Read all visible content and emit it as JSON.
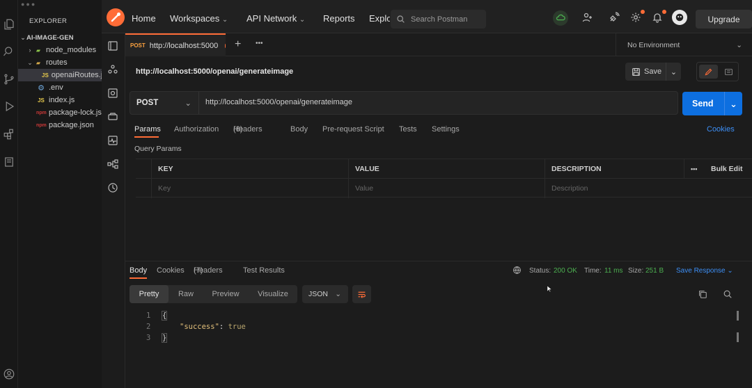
{
  "vscode": {
    "explorer_title": "EXPLORER",
    "project": "AI-IMAGE-GEN",
    "tree": [
      {
        "label": "node_modules",
        "type": "folder",
        "icon": "folder-icon",
        "expanded": false
      },
      {
        "label": "routes",
        "type": "folder",
        "icon": "folder-icon",
        "expanded": true
      },
      {
        "label": "openaiRoutes.js",
        "type": "js",
        "icon": "js-file-icon",
        "selected": true
      },
      {
        "label": ".env",
        "type": "env",
        "icon": "gear-icon"
      },
      {
        "label": "index.js",
        "type": "js",
        "icon": "js-file-icon"
      },
      {
        "label": "package-lock.json",
        "type": "json",
        "icon": "npm-icon"
      },
      {
        "label": "package.json",
        "type": "json",
        "icon": "npm-icon"
      }
    ],
    "file_icon_js": "JS",
    "file_icon_npm": "npm"
  },
  "postman": {
    "nav": [
      "Home",
      "Workspaces",
      "API Network",
      "Reports",
      "Explo"
    ],
    "search_placeholder": "Search Postman",
    "upgrade_label": "Upgrade",
    "tab": {
      "method": "POST",
      "label": "http://localhost:5000"
    },
    "environment": "No Environment",
    "request_title": "http://localhost:5000/openai/generateimage",
    "save_label": "Save",
    "method": "POST",
    "url": "http://localhost:5000/openai/generateimage",
    "send_label": "Send",
    "request_tabs": {
      "params": "Params",
      "authorization": "Authorization",
      "headers": "Headers",
      "headers_count": "(8)",
      "body": "Body",
      "prerequest": "Pre-request Script",
      "tests": "Tests",
      "settings": "Settings",
      "cookies": "Cookies"
    },
    "query_params_label": "Query Params",
    "params_table": {
      "headers": [
        "KEY",
        "VALUE",
        "DESCRIPTION"
      ],
      "bulk_edit": "Bulk Edit",
      "more": "•••",
      "placeholders": [
        "Key",
        "Value",
        "Description"
      ]
    },
    "response": {
      "tabs": {
        "body": "Body",
        "cookies": "Cookies",
        "headers": "Headers",
        "headers_count": "(7)",
        "test_results": "Test Results"
      },
      "status_label": "Status:",
      "status_value": "200 OK",
      "time_label": "Time:",
      "time_value": "11 ms",
      "size_label": "Size:",
      "size_value": "251 B",
      "save_response": "Save Response",
      "view_modes": [
        "Pretty",
        "Raw",
        "Preview",
        "Visualize"
      ],
      "format": "JSON",
      "code": {
        "line_numbers": [
          "1",
          "2",
          "3"
        ],
        "open": "{",
        "key": "\"success\"",
        "colon": ": ",
        "value": "true",
        "close": "}"
      }
    }
  },
  "colors": {
    "accent": "#ff6c37",
    "send": "#0d6fe0",
    "success": "#4caf50",
    "link": "#3d8ff6"
  }
}
